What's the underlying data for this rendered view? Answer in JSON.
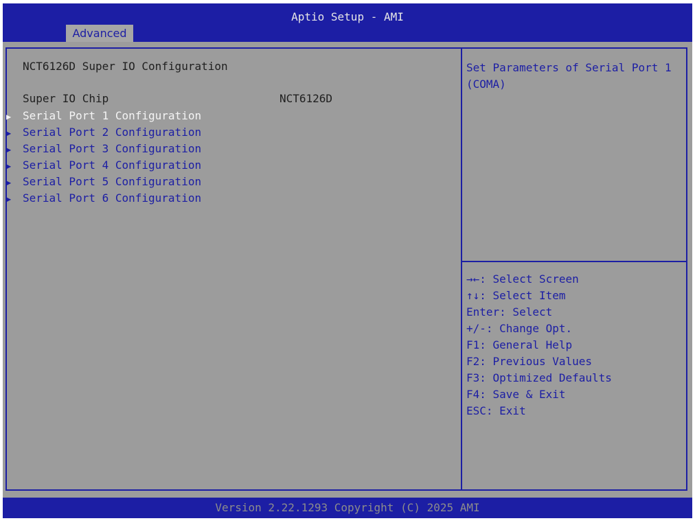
{
  "app": {
    "title": "Aptio Setup - AMI",
    "active_tab": "Advanced"
  },
  "main": {
    "heading": "NCT6126D Super IO Configuration",
    "chip_label": "Super IO Chip",
    "chip_value": "NCT6126D",
    "items": [
      {
        "label": "Serial Port 1 Configuration",
        "selected": true
      },
      {
        "label": "Serial Port 2 Configuration",
        "selected": false
      },
      {
        "label": "Serial Port 3 Configuration",
        "selected": false
      },
      {
        "label": "Serial Port 4 Configuration",
        "selected": false
      },
      {
        "label": "Serial Port 5 Configuration",
        "selected": false
      },
      {
        "label": "Serial Port 6 Configuration",
        "selected": false
      }
    ]
  },
  "help": {
    "text": "Set Parameters of Serial Port 1 (COMA)"
  },
  "keys": [
    "→←: Select Screen",
    "↑↓: Select Item",
    "Enter: Select",
    "+/-: Change Opt.",
    "F1: General Help",
    "F2: Previous Values",
    "F3: Optimized Defaults",
    "F4: Save & Exit",
    "ESC: Exit"
  ],
  "footer": {
    "version": "Version 2.22.1293 Copyright (C) 2025 AMI"
  },
  "icons": {
    "item_arrow": "triangle-right"
  },
  "colors": {
    "bar_blue": "#1c1ea4",
    "panel_gray": "#9c9c9c",
    "selected_text": "#f4f4f4"
  }
}
